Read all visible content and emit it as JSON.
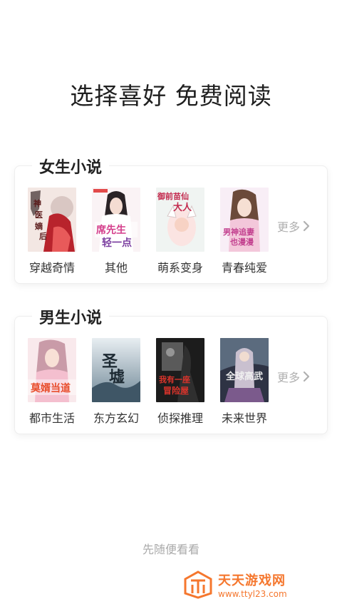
{
  "headline": "选择喜好 免费阅读",
  "female": {
    "title": "女生小说",
    "books": [
      {
        "label": "穿越奇情",
        "cover_text": "神医嫡后"
      },
      {
        "label": "其他",
        "cover_text": "席先生轻一点"
      },
      {
        "label": "萌系变身",
        "cover_text": "御前苗仙大人"
      },
      {
        "label": "青春纯爱",
        "cover_text": "男神追妻也漫漫"
      }
    ],
    "more": "更多"
  },
  "male": {
    "title": "男生小说",
    "books": [
      {
        "label": "都市生活",
        "cover_text": "莫婿当道"
      },
      {
        "label": "东方玄幻",
        "cover_text": "圣墟"
      },
      {
        "label": "侦探推理",
        "cover_text": "我有一座冒险屋"
      },
      {
        "label": "未来世界",
        "cover_text": "全球高武"
      }
    ],
    "more": "更多"
  },
  "skip": "先随便看看",
  "watermark": {
    "name": "天天游戏网",
    "url": "www.ttyl23.com"
  },
  "colors": {
    "accent": "#f5772e",
    "muted": "#aaaaaa"
  }
}
